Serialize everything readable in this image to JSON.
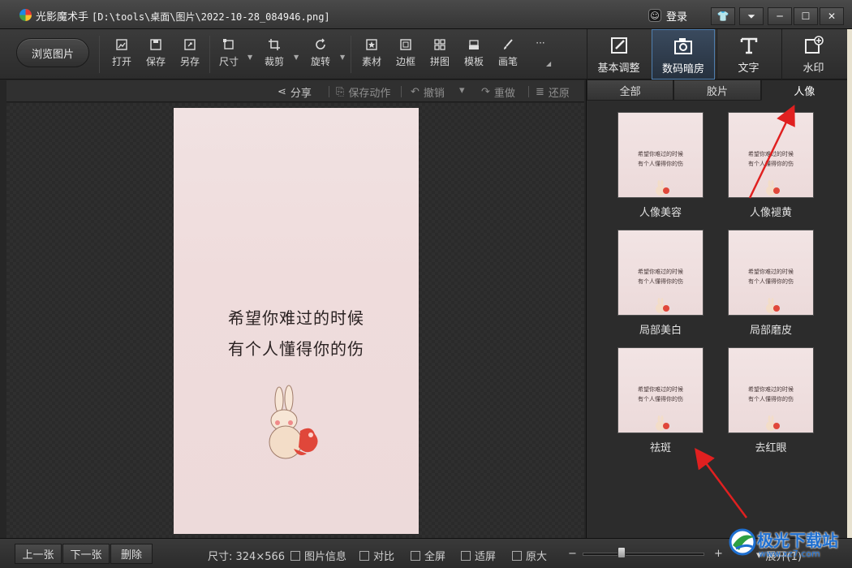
{
  "window": {
    "app_name": "光影魔术手",
    "path": "[D:\\tools\\桌面\\图片\\2022-10-28_084946.png]",
    "login_label": "登录",
    "buttons": [
      "skin",
      "menu",
      "minimize",
      "maximize",
      "close"
    ]
  },
  "toolbar": {
    "browse_label": "浏览图片",
    "tools": [
      {
        "label": "打开",
        "icon": "open-image-icon"
      },
      {
        "label": "保存",
        "icon": "save-icon"
      },
      {
        "label": "另存",
        "icon": "save-as-icon"
      },
      {
        "label": "尺寸",
        "icon": "resize-icon"
      },
      {
        "label": "裁剪",
        "icon": "crop-icon"
      },
      {
        "label": "旋转",
        "icon": "rotate-icon"
      },
      {
        "label": "素材",
        "icon": "material-icon"
      },
      {
        "label": "边框",
        "icon": "border-icon"
      },
      {
        "label": "拼图",
        "icon": "collage-icon"
      },
      {
        "label": "模板",
        "icon": "template-icon"
      },
      {
        "label": "画笔",
        "icon": "brush-icon"
      }
    ],
    "more_label": "···",
    "panels": [
      {
        "label": "基本调整",
        "icon": "basic-adjust-icon",
        "active": false
      },
      {
        "label": "数码暗房",
        "icon": "camera-icon",
        "active": true
      },
      {
        "label": "文字",
        "icon": "text-icon",
        "active": false
      },
      {
        "label": "水印",
        "icon": "watermark-icon",
        "active": false
      }
    ]
  },
  "subbar": {
    "share": "分享",
    "save_action": "保存动作",
    "undo": "撤销",
    "redo": "重做",
    "restore": "还原"
  },
  "photo": {
    "line1": "希望你难过的时候",
    "line2": "有个人懂得你的伤"
  },
  "right_panel": {
    "tabs": [
      {
        "label": "全部",
        "active": false
      },
      {
        "label": "胶片",
        "active": false
      },
      {
        "label": "人像",
        "active": true
      }
    ],
    "effects": [
      {
        "label": "人像美容"
      },
      {
        "label": "人像褪黄"
      },
      {
        "label": "局部美白"
      },
      {
        "label": "局部磨皮"
      },
      {
        "label": "祛斑"
      },
      {
        "label": "去红眼"
      }
    ],
    "thumb_line1": "希望你难过的时候",
    "thumb_line2": "有个人懂得你的伤"
  },
  "statusbar": {
    "prev": "上一张",
    "next": "下一张",
    "delete": "删除",
    "size": "尺寸: 324×566",
    "info": "图片信息",
    "compare": "对比",
    "fullscreen": "全屏",
    "fit": "适屏",
    "original": "原大",
    "zoom_minus": "−",
    "zoom_plus": "+",
    "zoom_level": 0.32,
    "expand": "展开(1)"
  },
  "watermark": {
    "text": "极光下载站",
    "url": "www.xz7.com"
  },
  "colors": {
    "annotation_arrow": "#e02020",
    "active_tab_border": "#4f7fb0",
    "watermark_blue": "#1e6fd0"
  }
}
